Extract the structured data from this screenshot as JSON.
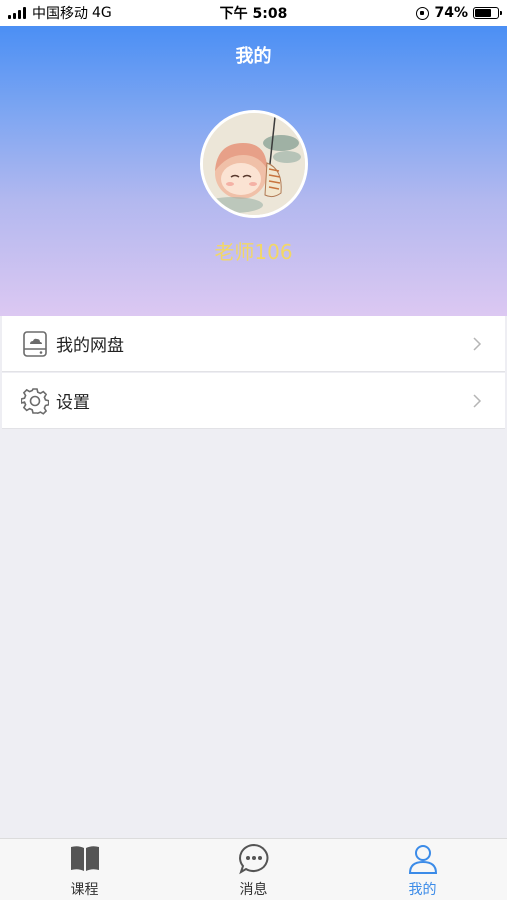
{
  "status_bar": {
    "carrier": "中国移动",
    "network": "4G",
    "time": "下午 5:08",
    "battery": "74%",
    "battery_level": 0.74
  },
  "header": {
    "title": "我的",
    "username": "老师106"
  },
  "menu": [
    {
      "label": "我的网盘",
      "icon": "drive-icon"
    },
    {
      "label": "设置",
      "icon": "gear-icon"
    }
  ],
  "tabs": [
    {
      "label": "课程",
      "icon": "book-icon",
      "active": false
    },
    {
      "label": "消息",
      "icon": "chat-icon",
      "active": false
    },
    {
      "label": "我的",
      "icon": "person-icon",
      "active": true
    }
  ],
  "colors": {
    "accent": "#3b8be8",
    "username": "#f2d766",
    "header_top": "#4b8ff4",
    "header_bottom": "#dcc8f2"
  }
}
